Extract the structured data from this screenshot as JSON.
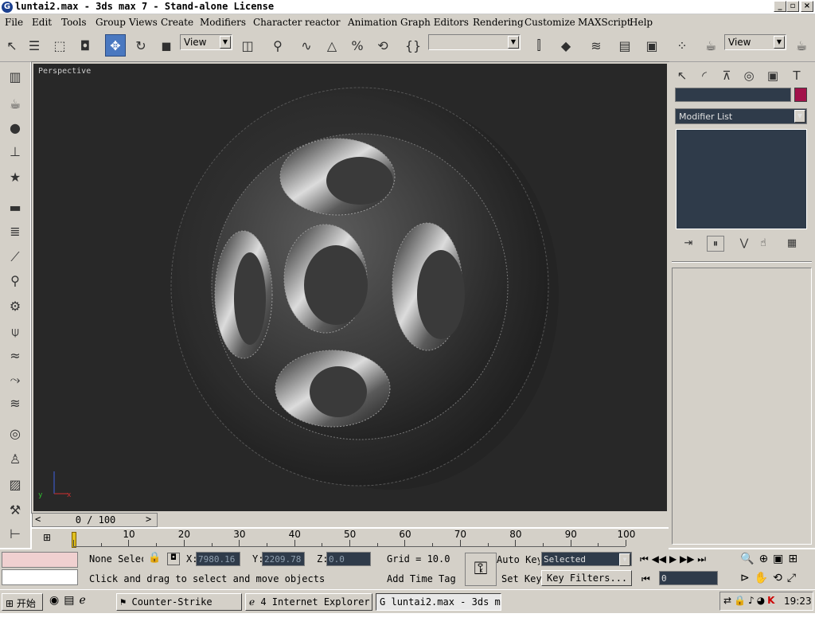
{
  "window": {
    "title": "luntai2.max - 3ds max 7  - Stand-alone License",
    "minimize_icon": "minimize-icon",
    "maximize_icon": "restore-icon",
    "close_icon": "close-icon"
  },
  "menu": [
    "File",
    "Edit",
    "Tools",
    "Group",
    "Views",
    "Create",
    "Modifiers",
    "Character",
    "reactor",
    "Animation",
    "Graph Editors",
    "Rendering",
    "Customize",
    "MAXScript",
    "Help"
  ],
  "toolbar": {
    "ref_coord_label": "View",
    "named_selection_label": "",
    "render_type_label": "View",
    "active_tool": "select-and-move"
  },
  "viewport": {
    "label": "Perspective",
    "axis": {
      "x": "x",
      "y": "y"
    }
  },
  "command_panel": {
    "object_name": "",
    "object_color": "#a2124a",
    "modifier_list_label": "Modifier List"
  },
  "time_slider": {
    "text": "0 / 100"
  },
  "track_ticks": [
    "10",
    "20",
    "30",
    "40",
    "50",
    "60",
    "70",
    "80",
    "90",
    "100"
  ],
  "status": {
    "selection": "None Selec",
    "x_label": "X:",
    "x_value": "7980.16",
    "y_label": "Y:",
    "y_value": "2209.78",
    "z_label": "Z:",
    "z_value": "0.0",
    "grid": "Grid = 10.0",
    "prompt": "Click and drag to select and move objects",
    "add_time_tag": "Add Time Tag",
    "auto_key": "Auto Key",
    "set_key": "Set Key",
    "selected": "Selected",
    "key_filters": "Key Filters...",
    "current_frame": "0"
  },
  "taskbar": {
    "start": "开始",
    "tasks": [
      "Counter-Strike",
      "4 Internet Explorer",
      "luntai2.max - 3ds m..."
    ],
    "clock": "19:23"
  }
}
